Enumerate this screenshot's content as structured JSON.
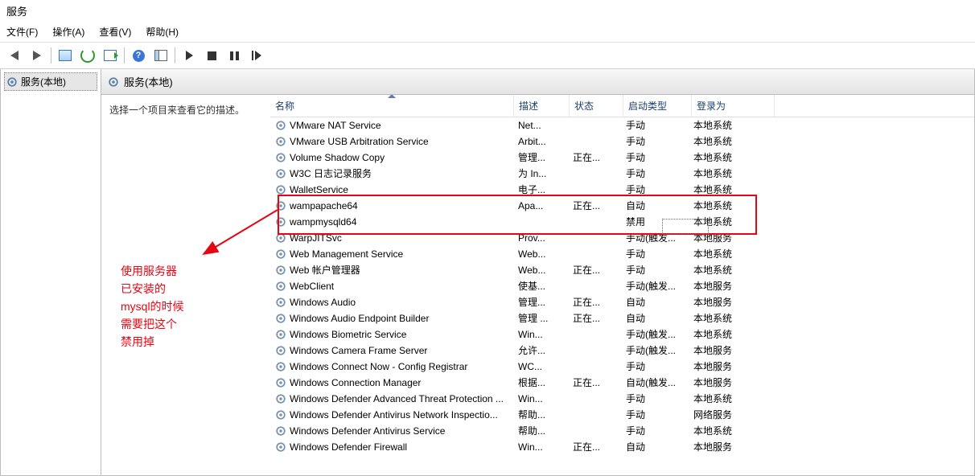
{
  "window_title": "服务",
  "menu": {
    "file": "文件(F)",
    "action": "操作(A)",
    "view": "查看(V)",
    "help": "帮助(H)"
  },
  "left_tree": {
    "root": "服务(本地)"
  },
  "right_header": "服务(本地)",
  "detail_text": "选择一个项目来查看它的描述。",
  "columns": {
    "name": "名称",
    "desc": "描述",
    "status": "状态",
    "startup": "启动类型",
    "logon": "登录为"
  },
  "rows": [
    {
      "name": "VMware NAT Service",
      "desc": "Net...",
      "status": "",
      "startup": "手动",
      "logon": "本地系统"
    },
    {
      "name": "VMware USB Arbitration Service",
      "desc": "Arbit...",
      "status": "",
      "startup": "手动",
      "logon": "本地系统"
    },
    {
      "name": "Volume Shadow Copy",
      "desc": "管理...",
      "status": "正在...",
      "startup": "手动",
      "logon": "本地系统"
    },
    {
      "name": "W3C 日志记录服务",
      "desc": "为 In...",
      "status": "",
      "startup": "手动",
      "logon": "本地系统"
    },
    {
      "name": "WalletService",
      "desc": "电子...",
      "status": "",
      "startup": "手动",
      "logon": "本地系统"
    },
    {
      "name": "wampapache64",
      "desc": "Apa...",
      "status": "正在...",
      "startup": "自动",
      "logon": "本地系统"
    },
    {
      "name": "wampmysqld64",
      "desc": "",
      "status": "",
      "startup": "禁用",
      "logon": "本地系统"
    },
    {
      "name": "WarpJITSvc",
      "desc": "Prov...",
      "status": "",
      "startup": "手动(触发...",
      "logon": "本地服务"
    },
    {
      "name": "Web Management Service",
      "desc": "Web...",
      "status": "",
      "startup": "手动",
      "logon": "本地系统"
    },
    {
      "name": "Web 帐户管理器",
      "desc": "Web...",
      "status": "正在...",
      "startup": "手动",
      "logon": "本地系统"
    },
    {
      "name": "WebClient",
      "desc": "使基...",
      "status": "",
      "startup": "手动(触发...",
      "logon": "本地服务"
    },
    {
      "name": "Windows Audio",
      "desc": "管理...",
      "status": "正在...",
      "startup": "自动",
      "logon": "本地服务"
    },
    {
      "name": "Windows Audio Endpoint Builder",
      "desc": "管理 ...",
      "status": "正在...",
      "startup": "自动",
      "logon": "本地系统"
    },
    {
      "name": "Windows Biometric Service",
      "desc": "Win...",
      "status": "",
      "startup": "手动(触发...",
      "logon": "本地系统"
    },
    {
      "name": "Windows Camera Frame Server",
      "desc": "允许...",
      "status": "",
      "startup": "手动(触发...",
      "logon": "本地服务"
    },
    {
      "name": "Windows Connect Now - Config Registrar",
      "desc": "WC...",
      "status": "",
      "startup": "手动",
      "logon": "本地服务"
    },
    {
      "name": "Windows Connection Manager",
      "desc": "根据...",
      "status": "正在...",
      "startup": "自动(触发...",
      "logon": "本地服务"
    },
    {
      "name": "Windows Defender Advanced Threat Protection ...",
      "desc": "Win...",
      "status": "",
      "startup": "手动",
      "logon": "本地系统"
    },
    {
      "name": "Windows Defender Antivirus Network Inspectio...",
      "desc": "帮助...",
      "status": "",
      "startup": "手动",
      "logon": "网络服务"
    },
    {
      "name": "Windows Defender Antivirus Service",
      "desc": "帮助...",
      "status": "",
      "startup": "手动",
      "logon": "本地系统"
    },
    {
      "name": "Windows Defender Firewall",
      "desc": "Win...",
      "status": "正在...",
      "startup": "自动",
      "logon": "本地服务"
    }
  ],
  "annotation": {
    "l1": "使用服务器",
    "l2": "已安装的",
    "l3": "mysql的时候",
    "l4": "需要把这个",
    "l5": "禁用掉"
  }
}
